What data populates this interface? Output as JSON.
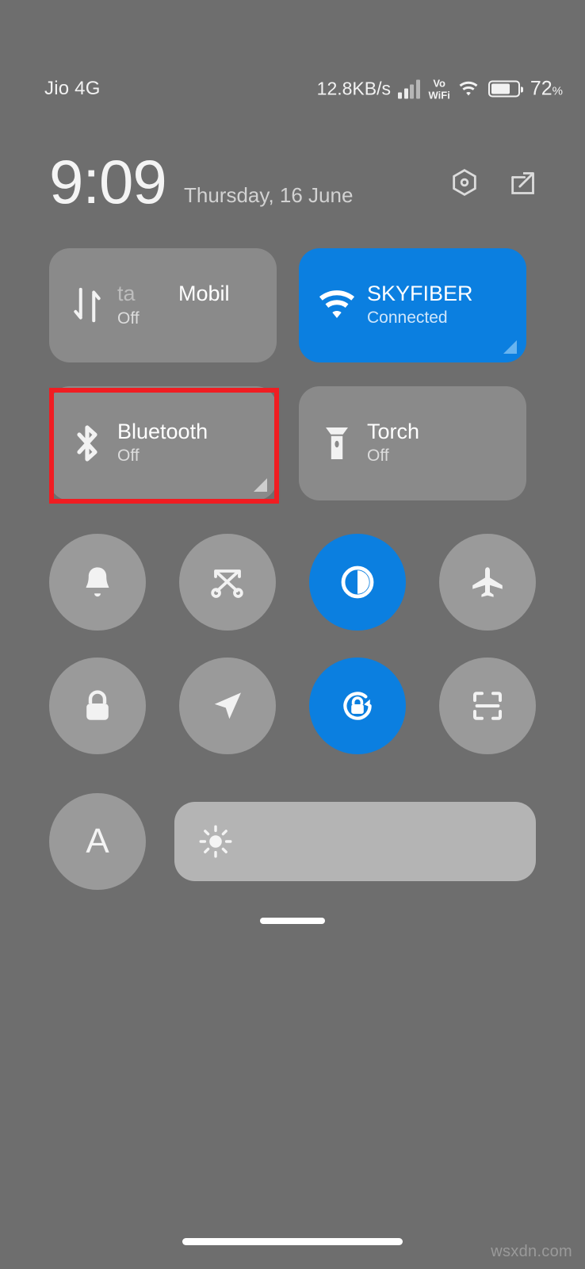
{
  "device": {
    "background_color": "#6e6e6e",
    "accent_color": "#0b7fe0",
    "annotation_color": "#f01d22"
  },
  "status_bar": {
    "carrier": "Jio 4G",
    "network_speed": "12.8KB/s",
    "signal_icon": "signal-bars-icon",
    "volte_line1": "Vo",
    "volte_line2": "WiFi",
    "wifi_icon": "wifi-icon",
    "battery_icon": "battery-icon",
    "battery_level": "72",
    "battery_percent_symbol": "%"
  },
  "header": {
    "time": "9:09",
    "date": "Thursday, 16 June",
    "settings_icon": "settings-hexagon-icon",
    "edit_icon": "edit-tiles-icon"
  },
  "big_tiles": [
    {
      "name": "mobile-data",
      "icon": "mobile-data-arrows-icon",
      "title_outgoing": "ta",
      "title_incoming": "Mobil",
      "subtitle": "Off",
      "active": false,
      "expandable": false,
      "annotated": false
    },
    {
      "name": "wifi",
      "icon": "wifi-icon",
      "title": "SKYFIBER",
      "subtitle": "Connected",
      "active": true,
      "expandable": true,
      "annotated": false
    },
    {
      "name": "bluetooth",
      "icon": "bluetooth-icon",
      "title": "Bluetooth",
      "subtitle": "Off",
      "active": false,
      "expandable": true,
      "annotated": true
    },
    {
      "name": "torch",
      "icon": "flashlight-icon",
      "title": "Torch",
      "subtitle": "Off",
      "active": false,
      "expandable": false,
      "annotated": false
    }
  ],
  "circle_toggles": [
    {
      "name": "ringer-bell",
      "icon": "bell-icon",
      "active": false
    },
    {
      "name": "screenshot",
      "icon": "screenshot-scissors-icon",
      "active": false
    },
    {
      "name": "dark-mode",
      "icon": "dark-mode-contrast-icon",
      "active": true
    },
    {
      "name": "airplane-mode",
      "icon": "airplane-icon",
      "active": false
    },
    {
      "name": "lock-screen",
      "icon": "lock-icon",
      "active": false
    },
    {
      "name": "location",
      "icon": "location-arrow-icon",
      "active": false
    },
    {
      "name": "rotation-lock",
      "icon": "rotation-lock-icon",
      "active": true
    },
    {
      "name": "scanner",
      "icon": "scan-frame-icon",
      "active": false
    }
  ],
  "brightness": {
    "auto_label": "A",
    "auto_active": false,
    "slider_icon": "sun-icon",
    "slider_value": 0
  },
  "footer": {
    "panel_handle": "drag-handle",
    "nav_bar": "gesture-nav-bar",
    "watermark": "wsxdn.com"
  }
}
